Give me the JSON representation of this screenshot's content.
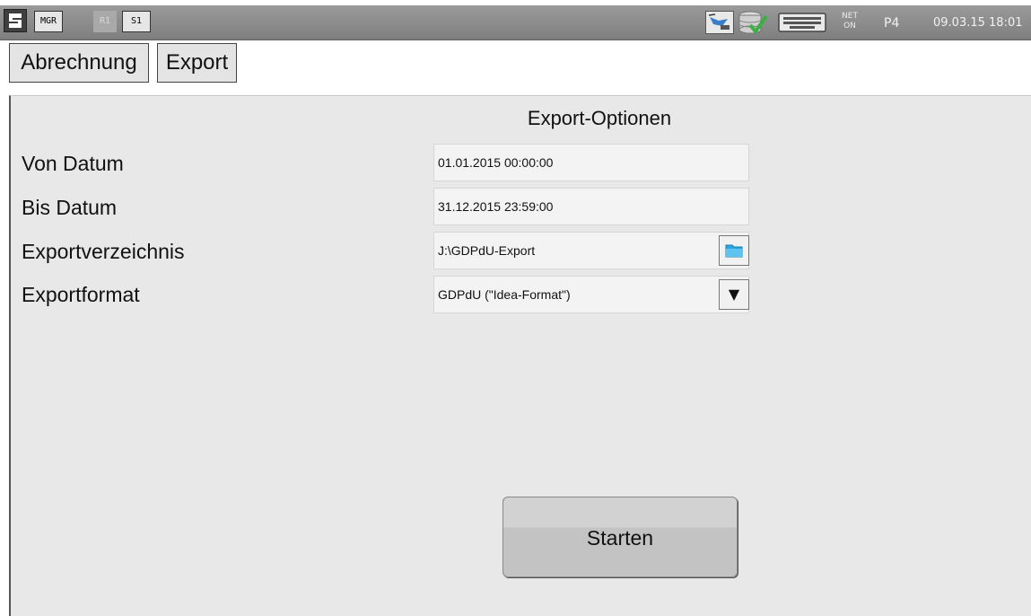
{
  "statusbar": {
    "modes": [
      "MGR",
      "R1",
      "S1"
    ],
    "net_line1": "NET",
    "net_line2": "ON",
    "profile": "P4",
    "datetime": "09.03.15  18:01",
    "icons": [
      "app-logo-icon",
      "network-printer-icon",
      "database-check-icon",
      "keyboard-icon"
    ]
  },
  "tabs": [
    "Abrechnung",
    "Export"
  ],
  "panel": {
    "title": "Export-Optionen",
    "fields": [
      {
        "label": "Von Datum",
        "value": "01.01.2015 00:00:00"
      },
      {
        "label": "Bis Datum",
        "value": "31.12.2015 23:59:00"
      },
      {
        "label": "Exportverzeichnis",
        "value": "J:\\GDPdU-Export",
        "action_icon": "folder-icon"
      },
      {
        "label": "Exportformat",
        "value": "GDPdU (\"Idea-Format\")",
        "action_icon": "dropdown-arrow-icon",
        "action_glyph": "▼"
      }
    ],
    "start_label": "Starten"
  },
  "colors": {
    "statusbar": "#8a8a8a",
    "panel": "#e8e8e8",
    "check_green": "#3cb043",
    "folder_blue": "#2aa7e0"
  }
}
